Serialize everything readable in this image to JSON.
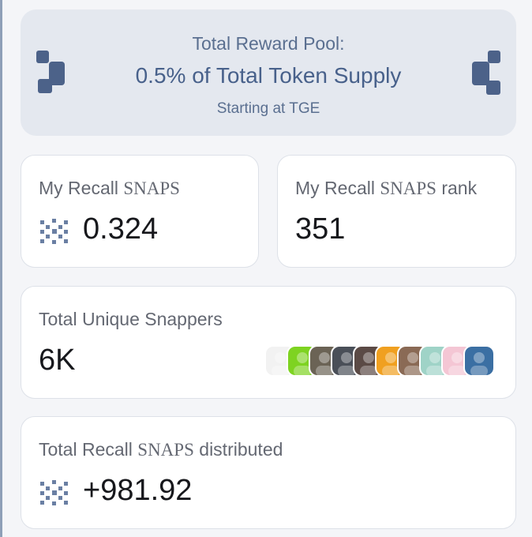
{
  "pool": {
    "title": "Total Reward Pool:",
    "amount": "0.5% of Total Token Supply",
    "start": "Starting at TGE"
  },
  "cards": {
    "my_snaps": {
      "label_pre": "My Recall ",
      "label_caps": "SNAPS",
      "label_post": "",
      "value": "0.324"
    },
    "my_rank": {
      "label_pre": "My Recall ",
      "label_caps": "SNAPS",
      "label_post": " rank",
      "value": "351"
    },
    "unique": {
      "label": "Total Unique Snappers",
      "value": "6K"
    },
    "distributed": {
      "label_pre": "Total Recall ",
      "label_caps": "SNAPS",
      "label_post": " distributed",
      "value": "+981.92"
    }
  },
  "icons": {
    "pool_logo": "recall-logo-icon",
    "snaps_mark": "snaps-token-icon"
  },
  "avatars": [
    {
      "name": "meme-face-avatar",
      "color": "#f2f2f2"
    },
    {
      "name": "green-avatar",
      "color": "#7ed321"
    },
    {
      "name": "portrait-avatar-1",
      "color": "#6b6355"
    },
    {
      "name": "portrait-avatar-2",
      "color": "#4a4f58"
    },
    {
      "name": "portrait-avatar-3",
      "color": "#5b4a45"
    },
    {
      "name": "sunburst-avatar",
      "color": "#f0a020"
    },
    {
      "name": "portrait-avatar-4",
      "color": "#8a6a55"
    },
    {
      "name": "anime-avatar-1",
      "color": "#9fd3c7"
    },
    {
      "name": "anime-avatar-2",
      "color": "#f4c6d4"
    },
    {
      "name": "portrait-avatar-5",
      "color": "#3b6fa3"
    }
  ],
  "colors": {
    "page_bg": "#f4f5f8",
    "pool_bg": "#e4e8ef",
    "pool_text": "#48618b",
    "accent_icon": "#4c6289"
  }
}
